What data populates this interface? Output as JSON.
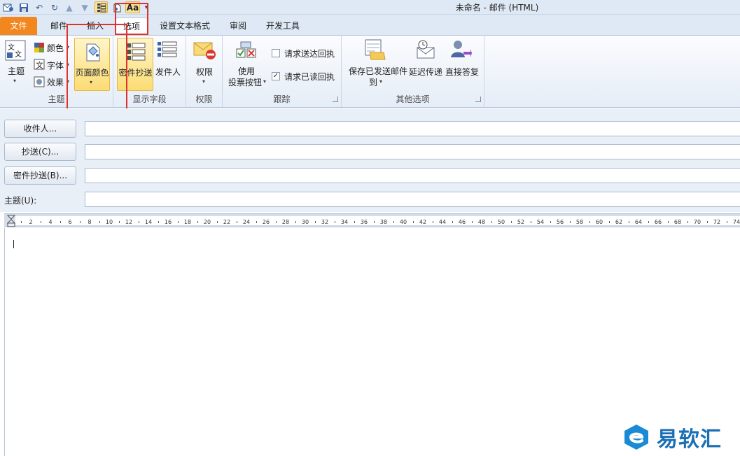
{
  "window": {
    "title": "未命名 - 邮件 (HTML)"
  },
  "quick_access": {
    "icons": [
      "outlook-icon",
      "save-icon",
      "undo-icon",
      "redo-icon",
      "up-arrow-icon",
      "down-arrow-icon",
      "display-fields-icon",
      "page-color-icon",
      "font-aa-icon",
      "customize-arrow-icon"
    ],
    "font_label": "Aa"
  },
  "tabs": [
    {
      "label": "文件"
    },
    {
      "label": "邮件"
    },
    {
      "label": "插入"
    },
    {
      "label": "选项"
    },
    {
      "label": "设置文本格式"
    },
    {
      "label": "审阅"
    },
    {
      "label": "开发工具"
    }
  ],
  "ribbon": {
    "theme_group": {
      "label": "主题",
      "theme_button": "主题",
      "colors": "颜色",
      "fonts": "字体",
      "effects": "效果",
      "page_color": "页面颜色"
    },
    "fields_group": {
      "label": "显示字段",
      "bcc": "密件抄送",
      "from": "发件人"
    },
    "permission_group": {
      "label": "权限",
      "permission": "权限"
    },
    "tracking_group": {
      "label": "跟踪",
      "voting_line1": "使用",
      "voting_line2": "投票按钮",
      "request_delivery": "请求送达回执",
      "request_delivery_checked": false,
      "request_read": "请求已读回执",
      "request_read_checked": true
    },
    "more_group": {
      "label": "其他选项",
      "save_sent_line1": "保存已发送邮件",
      "save_sent_line2": "到",
      "delay_delivery": "延迟传递",
      "direct_replies": "直接答复"
    }
  },
  "address": {
    "to_button": "收件人...",
    "cc_button": "抄送(C)...",
    "bcc_button": "密件抄送(B)...",
    "subject_label": "主题(U):",
    "to_value": "",
    "cc_value": "",
    "bcc_value": "",
    "subject_value": ""
  },
  "ruler": {
    "ticks": [
      "2",
      "4",
      "6",
      "8",
      "10",
      "12",
      "14",
      "16",
      "18",
      "20",
      "22",
      "24",
      "26",
      "28",
      "30",
      "32",
      "34",
      "36",
      "38",
      "40",
      "42",
      "44",
      "46",
      "48",
      "50",
      "52",
      "54",
      "56",
      "58",
      "60",
      "62",
      "64",
      "66",
      "68",
      "70",
      "72",
      "74"
    ]
  },
  "watermark": {
    "text": "易软汇"
  },
  "colors": {
    "file_tab": "#f2861f",
    "highlight": "#fbdc74",
    "annotation_red": "#e0322d",
    "brand_blue": "#1a6fb4"
  }
}
